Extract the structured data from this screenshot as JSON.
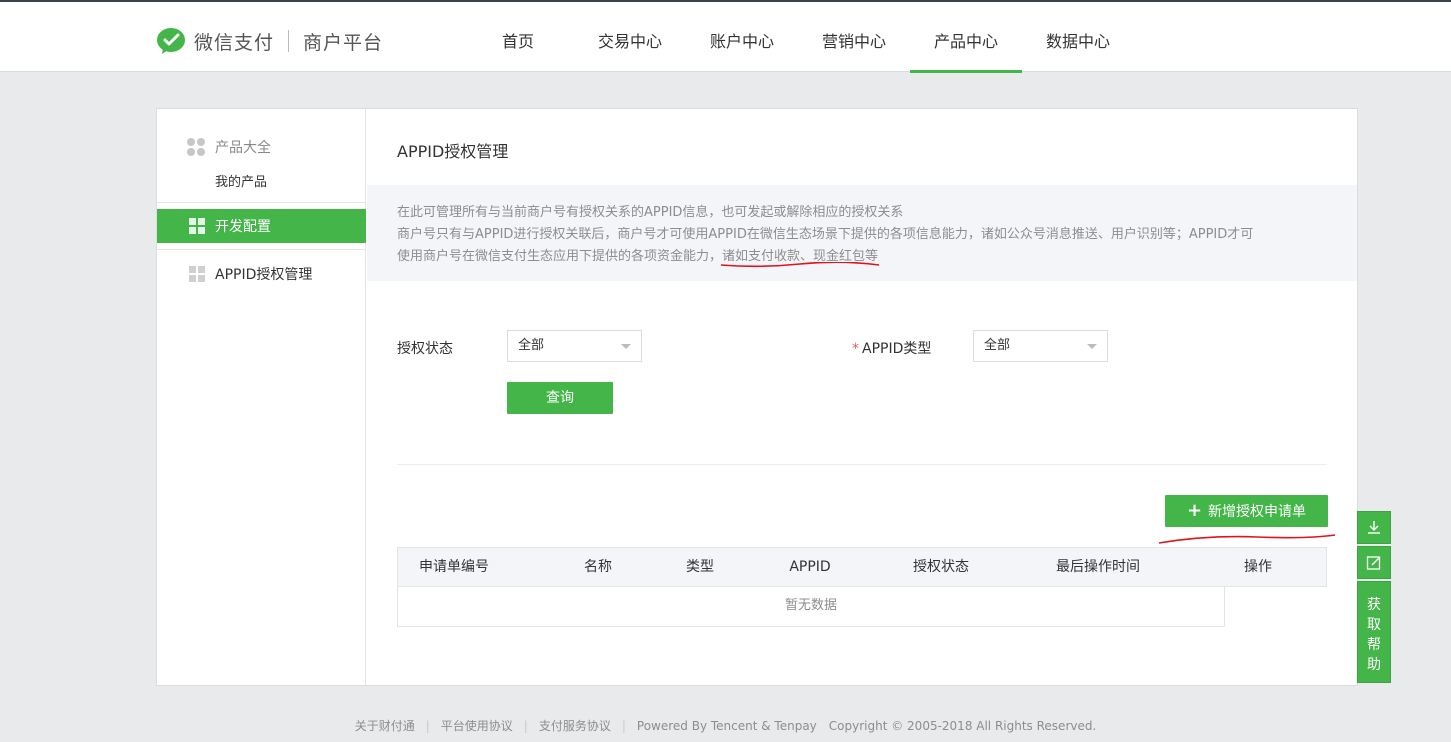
{
  "brand": {
    "name": "微信支付",
    "sub": "商户平台"
  },
  "nav": [
    "首页",
    "交易中心",
    "账户中心",
    "营销中心",
    "产品中心",
    "数据中心"
  ],
  "nav_active": "产品中心",
  "sidebar": {
    "group_label": "产品大全",
    "sub_item": "我的产品",
    "active_item": "开发配置",
    "item": "APPID授权管理"
  },
  "page": {
    "title": "APPID授权管理",
    "notice_line1": "在此可管理所有与当前商户号有授权关系的APPID信息，也可发起或解除相应的授权关系",
    "notice_line2": "商户号只有与APPID进行授权关联后，商户号才可使用APPID在微信生态场景下提供的各项信息能力，诸如公众号消息推送、用户识别等；APPID才可",
    "notice_line3_a": "使用商户号在微信支付生态应用下提供的各项资金能力，",
    "notice_line3_b": "诸如支付收款、现金红包",
    "notice_line3_c": "等"
  },
  "filters": {
    "status_label": "授权状态",
    "status_value": "全部",
    "type_star": "*",
    "type_label": "APPID类型",
    "type_value": "全部",
    "query_button": "查询"
  },
  "add_button": "新增授权申请单",
  "table": {
    "columns": [
      "申请单编号",
      "名称",
      "类型",
      "APPID",
      "授权状态",
      "最后操作时间",
      "操作"
    ],
    "empty_text": "暂无数据"
  },
  "help": {
    "chars": [
      "获",
      "取",
      "帮",
      "助"
    ]
  },
  "footer": {
    "links": [
      "关于财付通",
      "平台使用协议",
      "支付服务协议"
    ],
    "powered": "Powered By Tencent & Tenpay",
    "copyright": "Copyright © 2005-2018 All Rights Reserved."
  },
  "colors": {
    "accent": "#44b549",
    "annotation_red": "#e0141e"
  }
}
